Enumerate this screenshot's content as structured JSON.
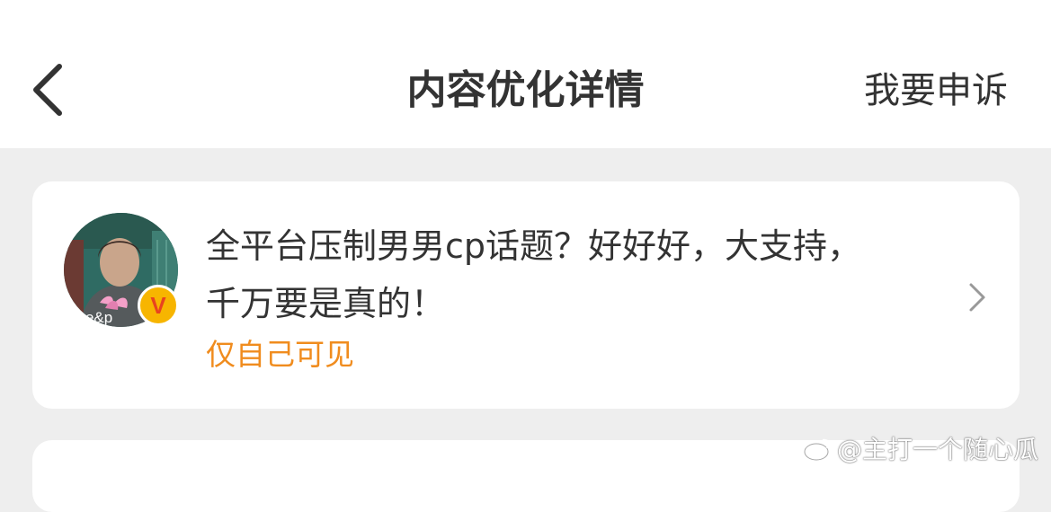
{
  "header": {
    "title": "内容优化详情",
    "appeal_label": "我要申诉",
    "back_icon": "chevron-left-icon"
  },
  "post": {
    "text": "全平台压制男男cp话题？好好好，大支持，千万要是真的！",
    "visibility": "仅自己可见",
    "avatar_caption": "ove&p",
    "badge": "V",
    "arrow_icon": "chevron-right-icon"
  },
  "watermark": {
    "text": "@主打一个随心瓜",
    "icon": "weibo-logo-icon"
  },
  "colors": {
    "background": "#eeeeee",
    "card": "#ffffff",
    "text": "#333333",
    "visibility": "#f08c1e",
    "badge": "#f7b500"
  }
}
